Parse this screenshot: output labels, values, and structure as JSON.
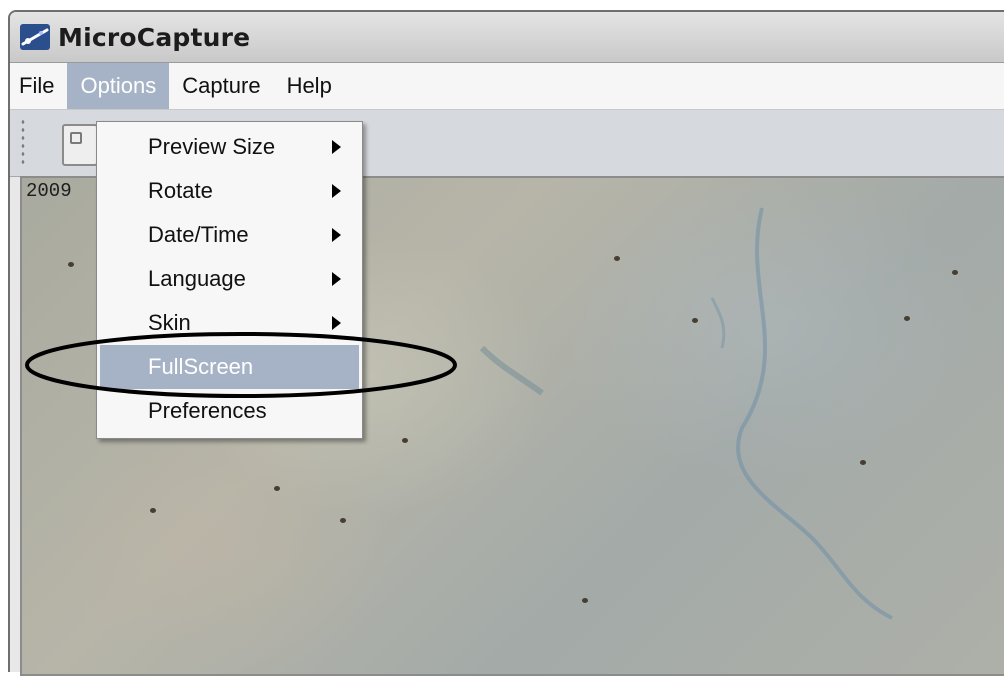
{
  "window": {
    "title": "MicroCapture"
  },
  "menubar": {
    "items": [
      "File",
      "Options",
      "Capture",
      "Help"
    ],
    "active": "Options"
  },
  "toolbar": {
    "tools": [
      "capture-icon"
    ]
  },
  "preview": {
    "timestamp": "2009"
  },
  "options_menu": {
    "items": [
      {
        "label": "Preview Size",
        "has_submenu": true
      },
      {
        "label": "Rotate",
        "has_submenu": true
      },
      {
        "label": "Date/Time",
        "has_submenu": true
      },
      {
        "label": "Language",
        "has_submenu": true
      },
      {
        "label": "Skin",
        "has_submenu": true
      },
      {
        "label": "FullScreen",
        "has_submenu": false,
        "highlighted": true
      },
      {
        "label": "Preferences",
        "has_submenu": false
      }
    ]
  },
  "colors": {
    "highlight": "#a6b3c6",
    "annotation": "#000000"
  }
}
